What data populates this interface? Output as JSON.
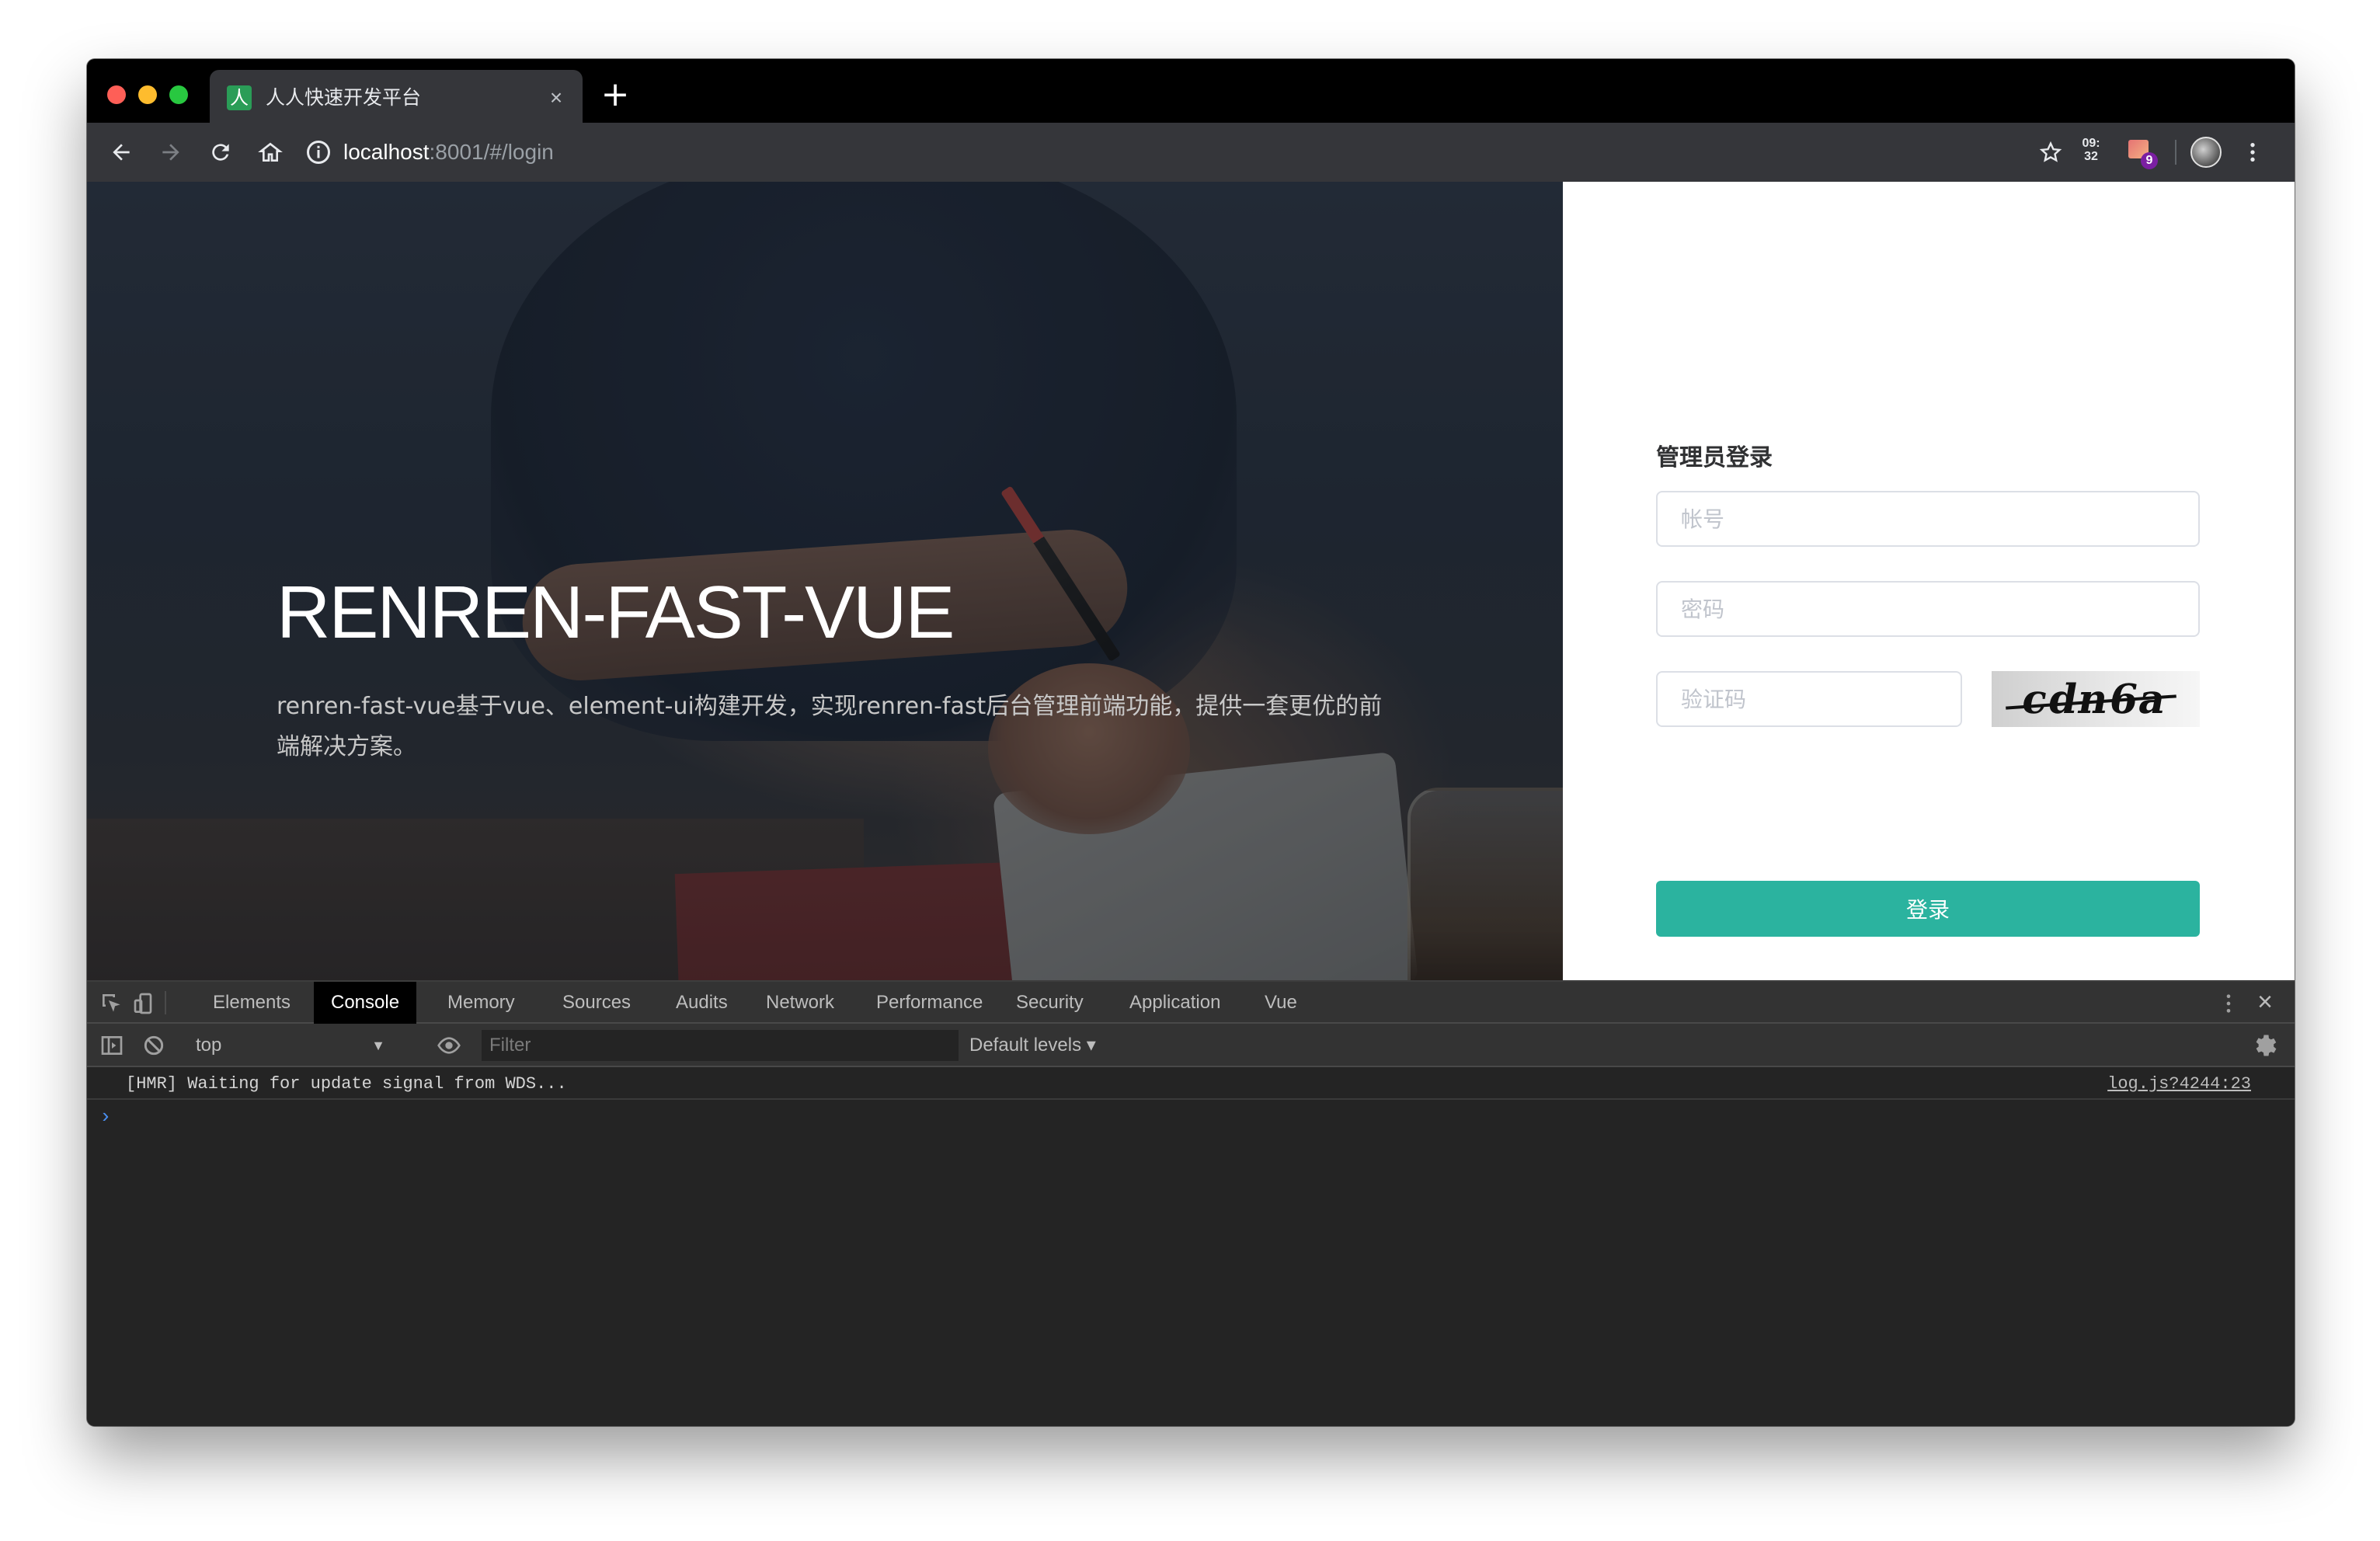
{
  "browser": {
    "tab": {
      "favicon_glyph": "人",
      "title": "人人快速开发平台",
      "close_glyph": "×"
    },
    "new_tab_glyph": "+",
    "address": {
      "host": "localhost",
      "rest": ":8001/#/login"
    },
    "extensions": {
      "clock_line1": "09:",
      "clock_line2": "32",
      "badge_count": "9"
    }
  },
  "page": {
    "hero": {
      "title": "RENREN-FAST-VUE",
      "description": "renren-fast-vue基于vue、element-ui构建开发，实现renren-fast后台管理前端功能，提供一套更优的前端解决方案。"
    },
    "login": {
      "title": "管理员登录",
      "username_placeholder": "帐号",
      "password_placeholder": "密码",
      "captcha_placeholder": "验证码",
      "captcha_text": "cdn6a",
      "submit_label": "登录",
      "accent_color": "#2bb39f"
    }
  },
  "devtools": {
    "tabs": [
      "Elements",
      "Console",
      "Memory",
      "Sources",
      "Audits",
      "Network",
      "Performance",
      "Security",
      "Application",
      "Vue"
    ],
    "active_tab": "Console",
    "context": "top",
    "filter_placeholder": "Filter",
    "levels": "Default levels ▾",
    "messages": [
      {
        "text": "[HMR] Waiting for update signal from WDS...",
        "source": "log.js?4244:23"
      }
    ],
    "prompt_glyph": "›"
  }
}
